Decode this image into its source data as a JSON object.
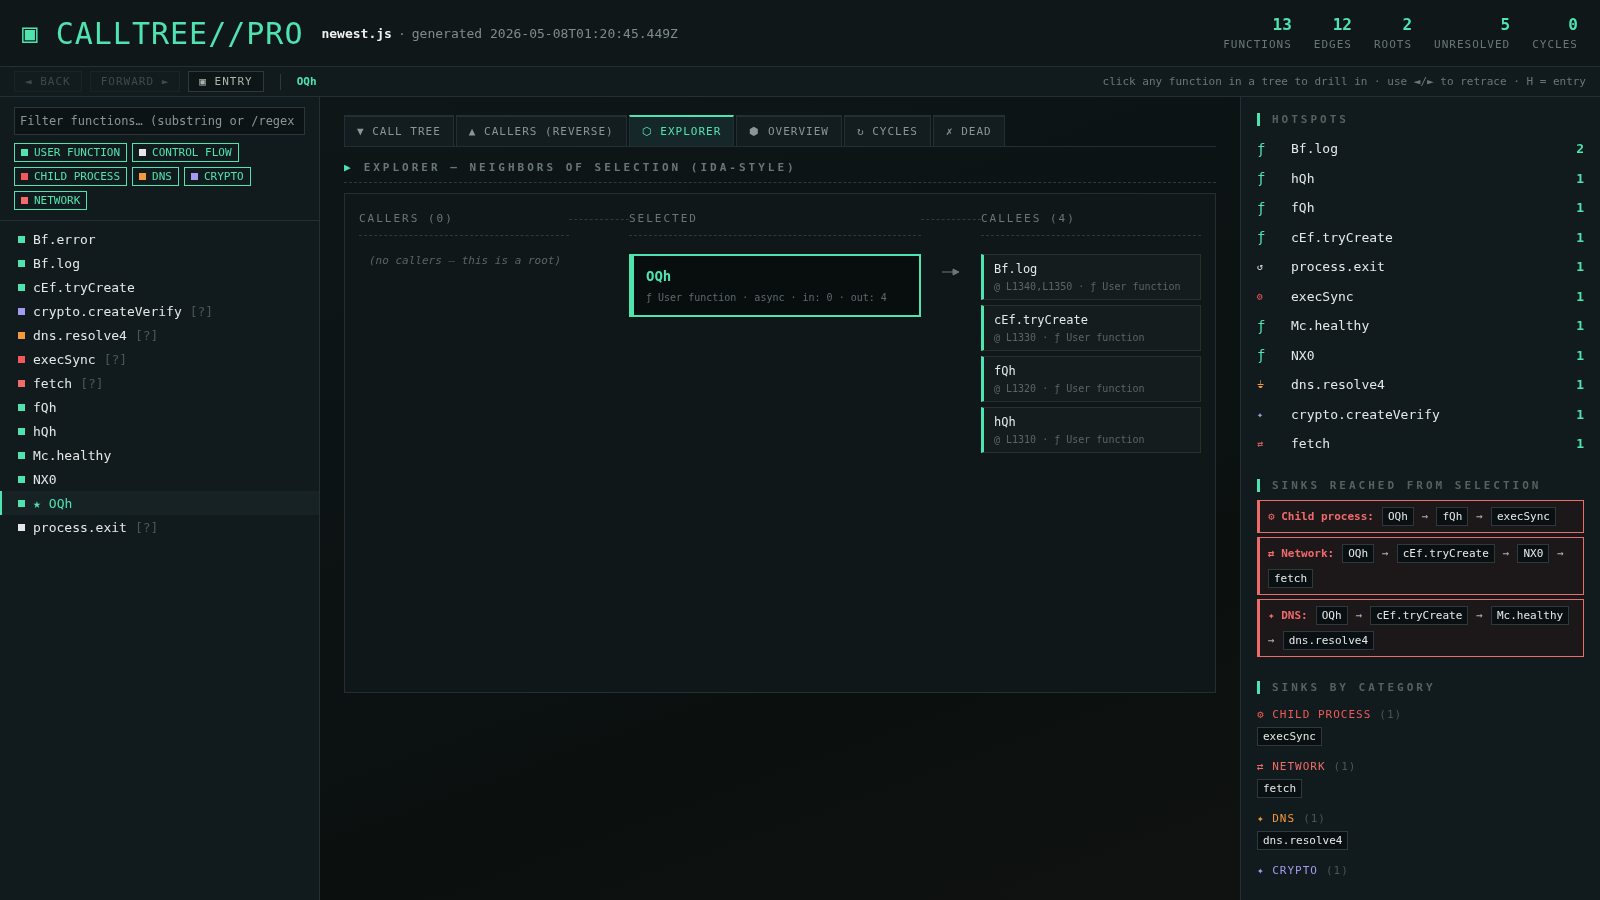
{
  "header": {
    "logo_glyph": "▣",
    "title": "CALLTREE//PRO",
    "file": "newest.js",
    "separator": "·",
    "generated": "generated 2026-05-08T01:20:45.449Z",
    "stats": [
      {
        "value": "13",
        "label": "FUNCTIONS"
      },
      {
        "value": "12",
        "label": "EDGES"
      },
      {
        "value": "2",
        "label": "ROOTS"
      },
      {
        "value": "5",
        "label": "UNRESOLVED"
      },
      {
        "value": "0",
        "label": "CYCLES"
      }
    ]
  },
  "toolbar": {
    "buttons": [
      {
        "label": "◄ BACK",
        "disabled": true
      },
      {
        "label": "FORWARD ►",
        "disabled": true
      },
      {
        "label": "▣ ENTRY",
        "disabled": false
      }
    ],
    "crumb": "OQh",
    "hint": "click any function in a tree to drill in · use ◄/► to retrace · H = entry"
  },
  "sidebar": {
    "filter": {
      "placeholder": "Filter functions… (substring or /regex"
    },
    "legend": [
      {
        "label": "USER FUNCTION",
        "kind": "user"
      },
      {
        "label": "CONTROL FLOW",
        "kind": "control"
      },
      {
        "label": "CHILD PROCESS",
        "kind": "child"
      },
      {
        "label": "DNS",
        "kind": "dns"
      },
      {
        "label": "CRYPTO",
        "kind": "crypto"
      },
      {
        "label": "NETWORK",
        "kind": "network"
      }
    ],
    "items": [
      {
        "name": "Bf.error",
        "kind": "user",
        "selected": false
      },
      {
        "name": "Bf.log",
        "kind": "user",
        "selected": false
      },
      {
        "name": "cEf.tryCreate",
        "kind": "user",
        "selected": false
      },
      {
        "name": "crypto.createVerify",
        "kind": "crypto",
        "selected": false,
        "tag": "[?]"
      },
      {
        "name": "dns.resolve4",
        "kind": "dns",
        "selected": false,
        "tag": "[?]"
      },
      {
        "name": "execSync",
        "kind": "child",
        "selected": false,
        "tag": "[?]"
      },
      {
        "name": "fetch",
        "kind": "network",
        "selected": false,
        "tag": "[?]"
      },
      {
        "name": "fQh",
        "kind": "user",
        "selected": false
      },
      {
        "name": "hQh",
        "kind": "user",
        "selected": false
      },
      {
        "name": "Mc.healthy",
        "kind": "user",
        "selected": false
      },
      {
        "name": "NX0",
        "kind": "user",
        "selected": false
      },
      {
        "name": "OQh",
        "kind": "user",
        "selected": true,
        "star": "★"
      },
      {
        "name": "process.exit",
        "kind": "control",
        "selected": false,
        "tag": "[?]"
      }
    ]
  },
  "tabs": [
    {
      "label": "▼ CALL TREE",
      "selected": false
    },
    {
      "label": "▲ CALLERS (REVERSE)",
      "selected": false
    },
    {
      "label": "⬡ EXPLORER",
      "selected": true
    },
    {
      "label": "⬢ OVERVIEW",
      "selected": false
    },
    {
      "label": "↻ CYCLES",
      "selected": false
    },
    {
      "label": "✗ DEAD",
      "selected": false
    }
  ],
  "explorer": {
    "heading_glyph": "▶",
    "heading": "EXPLORER — NEIGHBORS OF SELECTION (IDA-STYLE)",
    "callers": {
      "title": "CALLERS (0)",
      "empty": "(no callers — this is a root)"
    },
    "selected": {
      "title": "SELECTED",
      "name": "OQh",
      "meta": "ƒ User function · async · in: 0 · out: 4"
    },
    "callees": {
      "title": "CALLEES (4)",
      "items": [
        {
          "name": "Bf.log",
          "meta": "@ L1340,L1350 · ƒ User function"
        },
        {
          "name": "cEf.tryCreate",
          "meta": "@ L1330 · ƒ User function"
        },
        {
          "name": "fQh",
          "meta": "@ L1320 · ƒ User function"
        },
        {
          "name": "hQh",
          "meta": "@ L1310 · ƒ User function"
        }
      ]
    }
  },
  "hotspots": {
    "title": "HOTSPOTS",
    "items": [
      {
        "glyph": "ƒ",
        "kind": "user",
        "name": "Bf.log",
        "count": "2"
      },
      {
        "glyph": "ƒ",
        "kind": "user",
        "name": "hQh",
        "count": "1"
      },
      {
        "glyph": "ƒ",
        "kind": "user",
        "name": "fQh",
        "count": "1"
      },
      {
        "glyph": "ƒ",
        "kind": "user",
        "name": "cEf.tryCreate",
        "count": "1"
      },
      {
        "glyph": "↺",
        "kind": "control",
        "name": "process.exit",
        "count": "1"
      },
      {
        "glyph": "⚙",
        "kind": "child",
        "name": "execSync",
        "count": "1"
      },
      {
        "glyph": "ƒ",
        "kind": "user",
        "name": "Mc.healthy",
        "count": "1"
      },
      {
        "glyph": "ƒ",
        "kind": "user",
        "name": "NX0",
        "count": "1"
      },
      {
        "glyph": "⏚",
        "kind": "dns",
        "name": "dns.resolve4",
        "count": "1"
      },
      {
        "glyph": "✦",
        "kind": "crypto",
        "name": "crypto.createVerify",
        "count": "1"
      },
      {
        "glyph": "⇄",
        "kind": "network",
        "name": "fetch",
        "count": "1"
      }
    ]
  },
  "sinks_reached": {
    "title": "SINKS REACHED FROM SELECTION",
    "arrow": "→",
    "items": [
      {
        "glyph": "⚙",
        "label": "Child process:",
        "path": [
          "OQh",
          "fQh",
          "execSync"
        ]
      },
      {
        "glyph": "⇄",
        "label": "Network:",
        "path": [
          "OQh",
          "cEf.tryCreate",
          "NX0",
          "fetch"
        ]
      },
      {
        "glyph": "✦",
        "label": "DNS:",
        "path": [
          "OQh",
          "cEf.tryCreate",
          "Mc.healthy",
          "dns.resolve4"
        ]
      }
    ]
  },
  "sinks_by_category": {
    "title": "SINKS BY CATEGORY",
    "items": [
      {
        "glyph": "⚙",
        "kind": "child",
        "label": "CHILD PROCESS",
        "count": "(1)",
        "functions": [
          "execSync"
        ]
      },
      {
        "glyph": "⇄",
        "kind": "network",
        "label": "NETWORK",
        "count": "(1)",
        "functions": [
          "fetch"
        ]
      },
      {
        "glyph": "✦",
        "kind": "dns",
        "label": "DNS",
        "count": "(1)",
        "functions": [
          "dns.resolve4"
        ]
      },
      {
        "glyph": "✦",
        "kind": "crypto",
        "label": "CRYPTO",
        "count": "(1)"
      }
    ]
  }
}
